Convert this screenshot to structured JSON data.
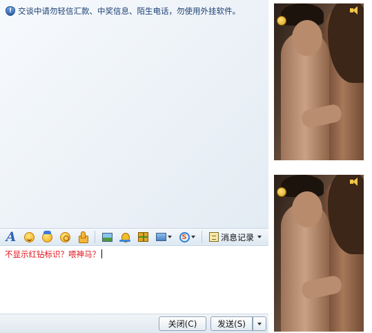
{
  "notice": {
    "text": "交谈中请勿轻信汇款、中奖信息、陌生电话，勿使用外挂软件。"
  },
  "toolbar": {
    "font_icon_glyph": "A",
    "s_icon_glyph": "S",
    "message_history_label": "消息记录"
  },
  "input": {
    "text": "不显示红钻标识？喂神马？"
  },
  "footer": {
    "close_label": "关闭(C)",
    "send_label": "发送(S)"
  },
  "colors": {
    "input_text": "#e0131b",
    "notice_text": "#1b3f73",
    "accent": "#2c63b7"
  },
  "icons": [
    "shield-icon",
    "font-icon",
    "smile-icon",
    "mad-icon",
    "wink-icon",
    "thumb-icon",
    "image-icon",
    "shake-icon",
    "gift-icon",
    "screenshot-icon",
    "s-icon",
    "history-icon",
    "chevron-down-icon",
    "person-icon",
    "speaker-icon"
  ]
}
